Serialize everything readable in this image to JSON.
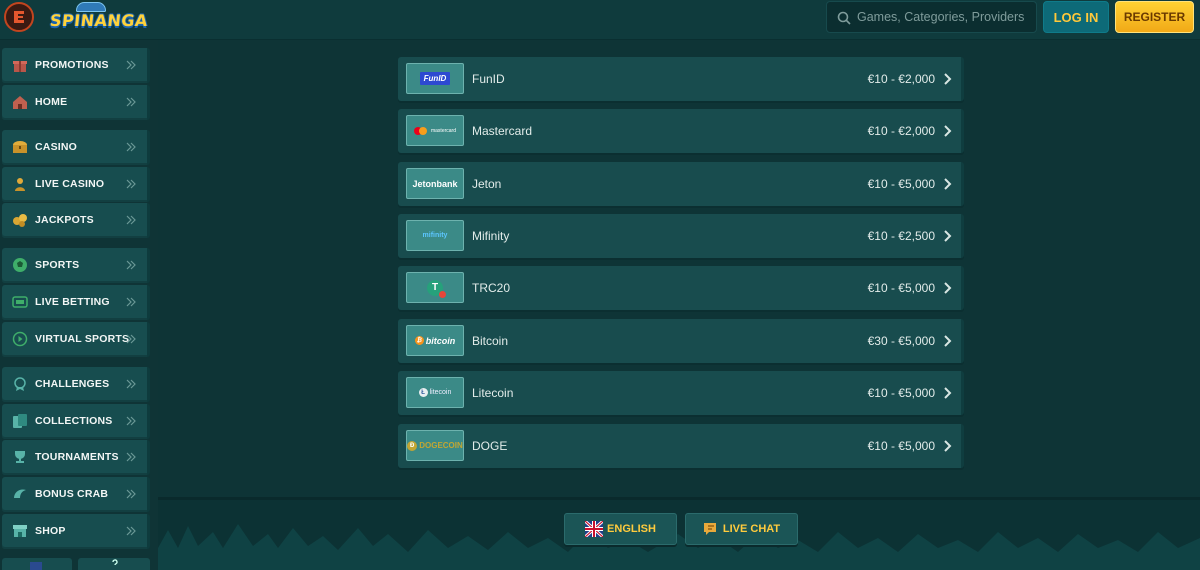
{
  "header": {
    "logo_text": "SPINANGA",
    "search_placeholder": "Games, Categories, Providers",
    "login_label": "LOG IN",
    "register_label": "REGISTER"
  },
  "sidebar": {
    "items": [
      {
        "label": "PROMOTIONS",
        "icon": "gift-icon"
      },
      {
        "label": "HOME",
        "icon": "home-icon"
      },
      {
        "label": "CASINO",
        "icon": "treasure-chest-icon"
      },
      {
        "label": "LIVE CASINO",
        "icon": "dealer-icon"
      },
      {
        "label": "JACKPOTS",
        "icon": "coins-icon"
      },
      {
        "label": "SPORTS",
        "icon": "soccer-ball-icon"
      },
      {
        "label": "LIVE BETTING",
        "icon": "live-tv-icon"
      },
      {
        "label": "VIRTUAL SPORTS",
        "icon": "play-circle-icon"
      },
      {
        "label": "CHALLENGES",
        "icon": "medal-icon"
      },
      {
        "label": "COLLECTIONS",
        "icon": "cards-icon"
      },
      {
        "label": "TOURNAMENTS",
        "icon": "trophy-icon"
      },
      {
        "label": "BONUS CRAB",
        "icon": "crab-icon"
      },
      {
        "label": "SHOP",
        "icon": "shop-icon"
      }
    ]
  },
  "payments": [
    {
      "name": "FunID",
      "range": "€10 - €2,000",
      "logo_text": "FunID"
    },
    {
      "name": "Mastercard",
      "range": "€10 - €2,000",
      "logo_text": "mastercard"
    },
    {
      "name": "Jeton",
      "range": "€10 - €5,000",
      "logo_text": "Jetonbank"
    },
    {
      "name": "Mifinity",
      "range": "€10 - €2,500",
      "logo_text": "mifinity"
    },
    {
      "name": "TRC20",
      "range": "€10 - €5,000",
      "logo_text": "T"
    },
    {
      "name": "Bitcoin",
      "range": "€30 - €5,000",
      "logo_text": "bitcoin"
    },
    {
      "name": "Litecoin",
      "range": "€10 - €5,000",
      "logo_text": "litecoin"
    },
    {
      "name": "DOGE",
      "range": "€10 - €5,000",
      "logo_text": "DOGECOIN"
    }
  ],
  "footer": {
    "language_label": "ENGLISH",
    "chat_label": "LIVE CHAT"
  },
  "colors": {
    "accent_yellow": "#ffc93b",
    "panel_teal": "#184c4e",
    "background": "#0e3436"
  }
}
